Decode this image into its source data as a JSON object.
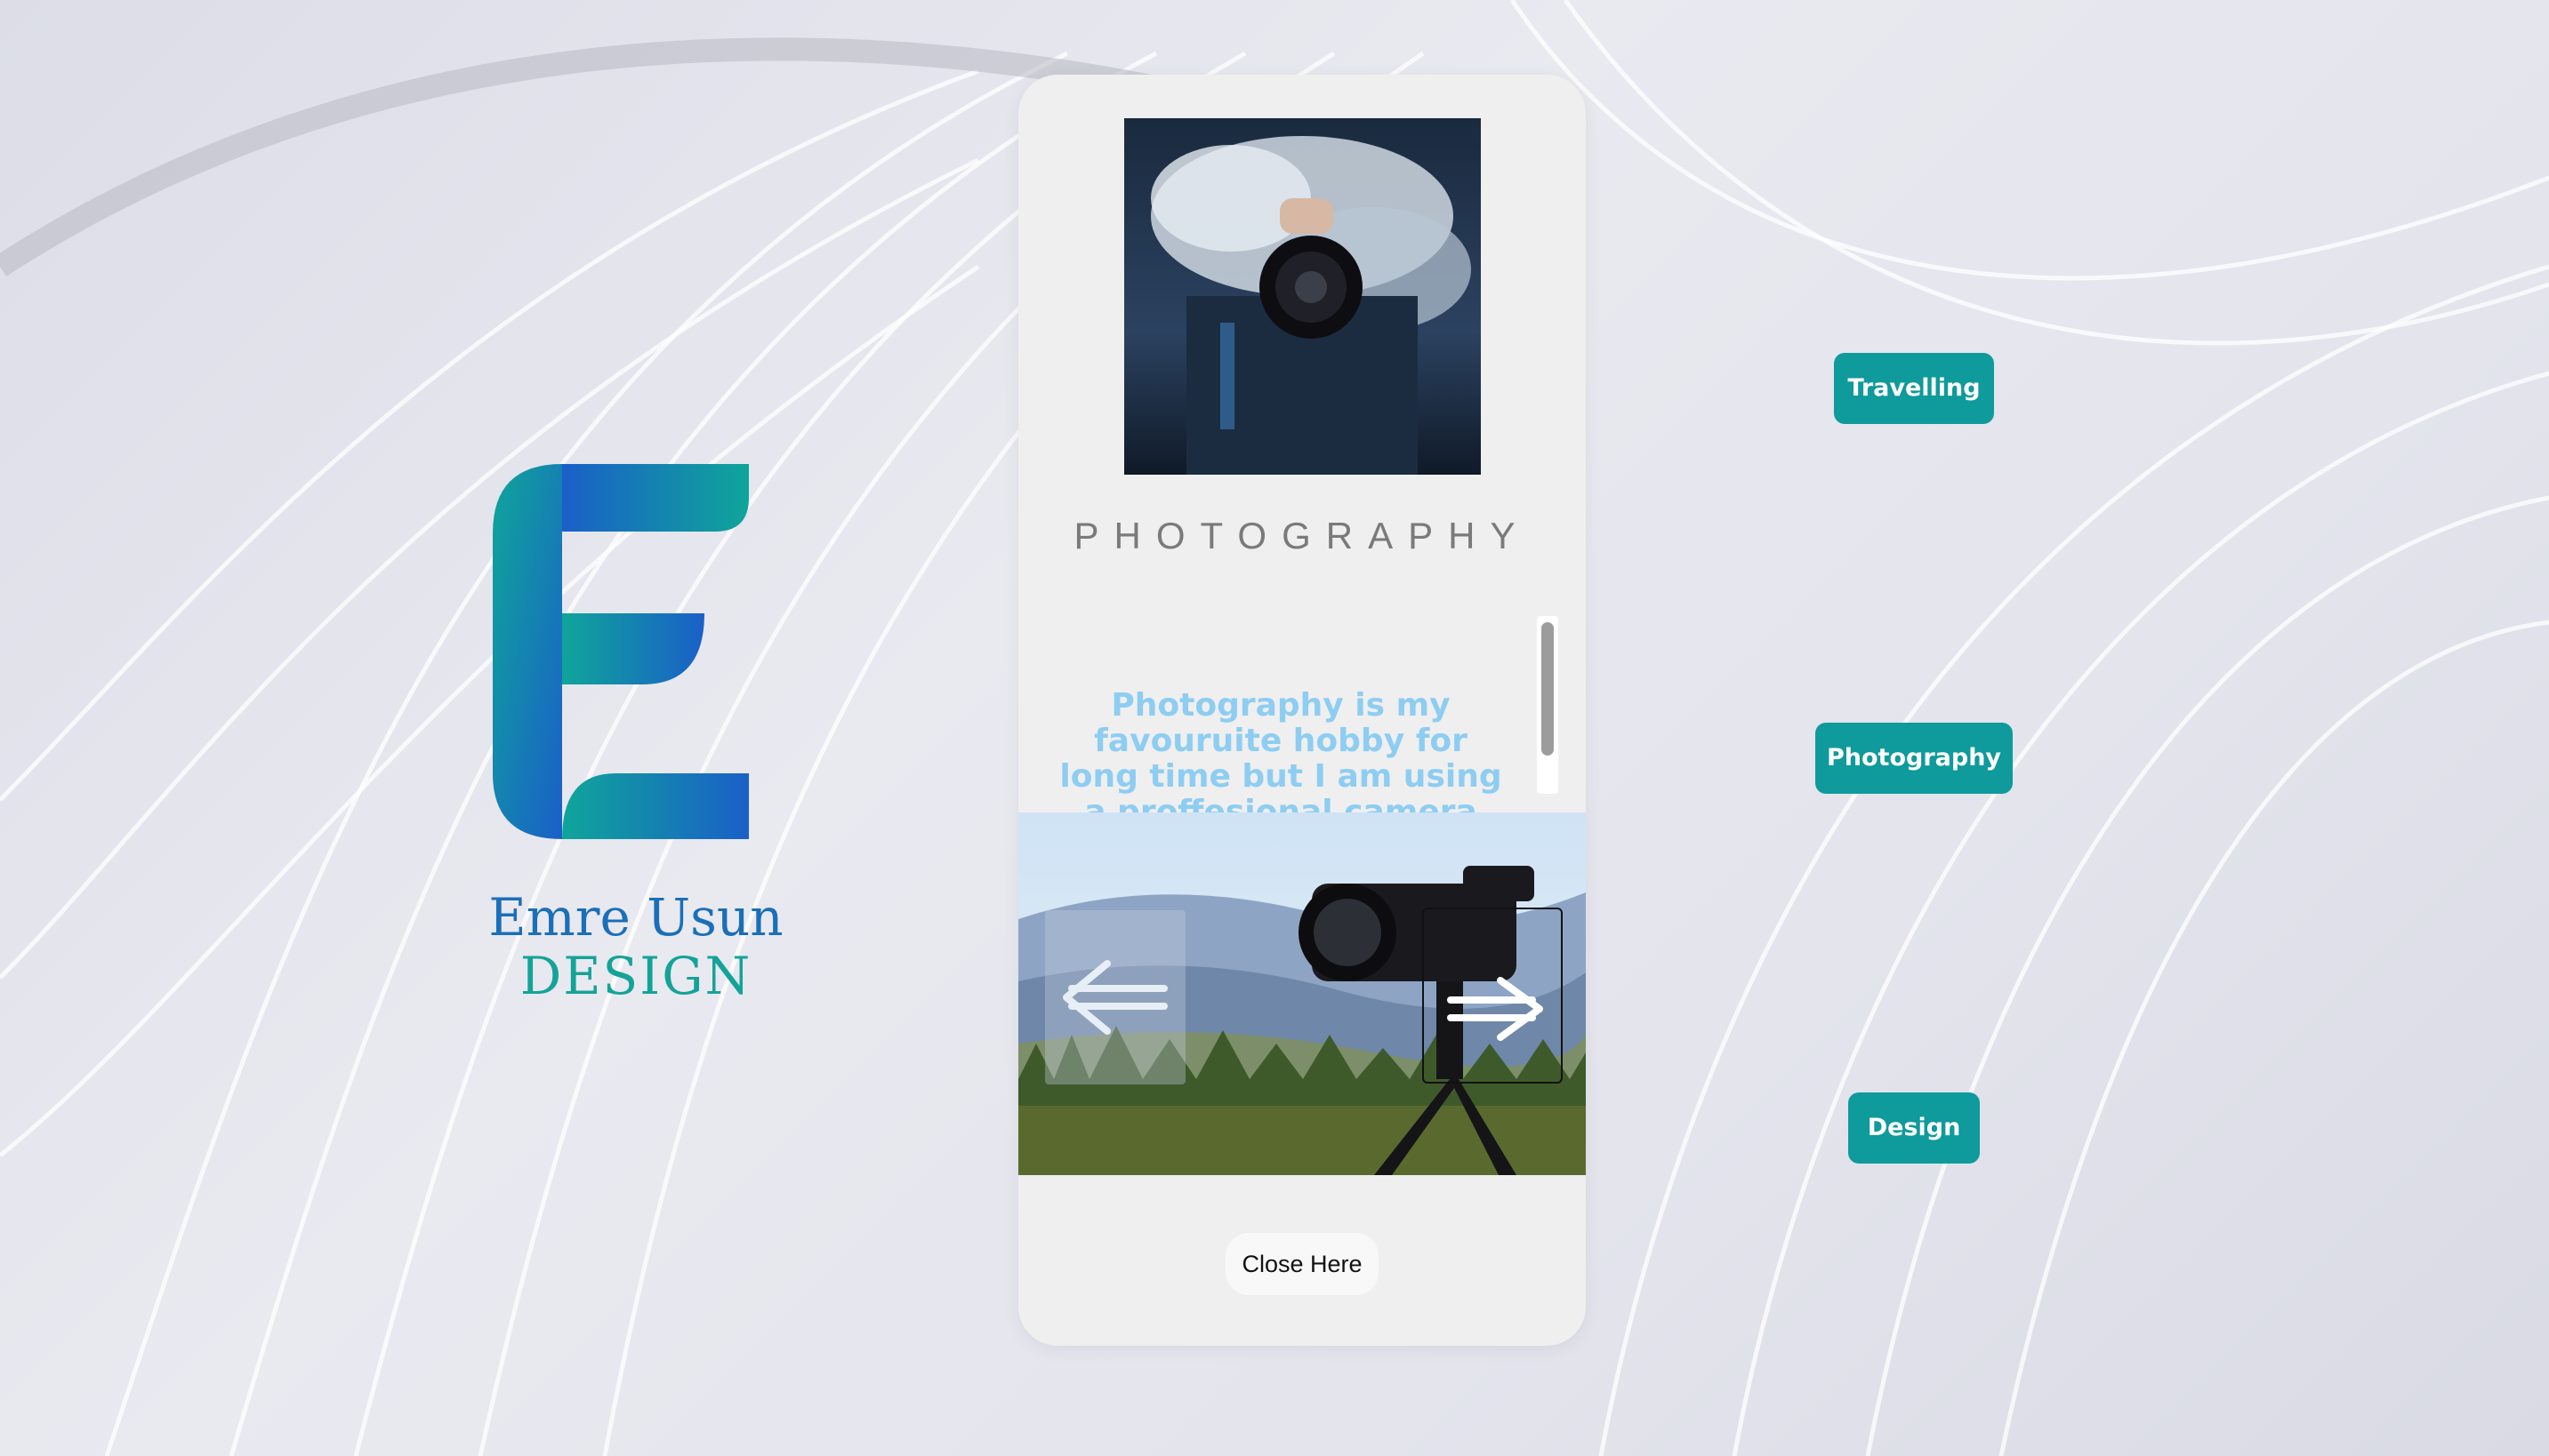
{
  "brand": {
    "name": "Emre Usun",
    "subtitle": "DESIGN",
    "logo_letter": "E"
  },
  "modal": {
    "title": "PHOTOGRAPHY",
    "description": "Photography is my favouruite hobby for long time but I am using a proffesional camera only for a few years. I like to take photos of people, nature",
    "top_image": "photographer-holding-camera-in-smoke",
    "slider_image": "camera-on-tripod-mountain-landscape",
    "prev_icon": "arrow-left-icon",
    "next_icon": "arrow-right-icon",
    "close_label": "Close Here"
  },
  "nav": {
    "travelling": "Travelling",
    "photography": "Photography",
    "design": "Design"
  },
  "colors": {
    "accent": "#0f9a9c",
    "logo_blue": "#1a6fb8",
    "logo_teal": "#14a398",
    "description_text": "#8ecdf2"
  }
}
